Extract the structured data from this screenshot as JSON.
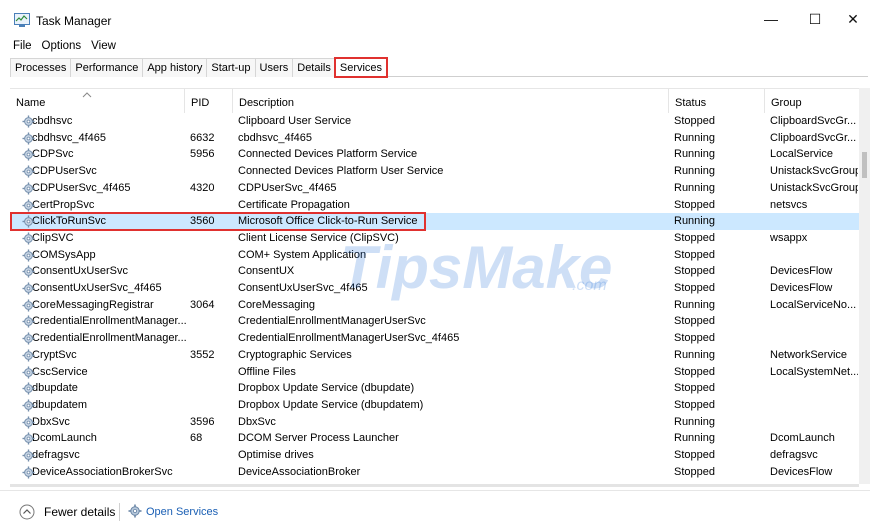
{
  "window": {
    "title": "Task Manager",
    "min_glyph": "—",
    "max_glyph": "☐",
    "close_glyph": "✕"
  },
  "menu": [
    "File",
    "Options",
    "View"
  ],
  "tabs": [
    {
      "label": "Processes",
      "active": false
    },
    {
      "label": "Performance",
      "active": false
    },
    {
      "label": "App history",
      "active": false
    },
    {
      "label": "Start-up",
      "active": false
    },
    {
      "label": "Users",
      "active": false
    },
    {
      "label": "Details",
      "active": false
    },
    {
      "label": "Services",
      "active": true
    }
  ],
  "columns": {
    "name": "Name",
    "pid": "PID",
    "description": "Description",
    "status": "Status",
    "group": "Group"
  },
  "rows": [
    {
      "name": "cbdhsvc",
      "pid": "",
      "description": "Clipboard User Service",
      "status": "Stopped",
      "group": "ClipboardSvcGr..."
    },
    {
      "name": "cbdhsvc_4f465",
      "pid": "6632",
      "description": "cbdhsvc_4f465",
      "status": "Running",
      "group": "ClipboardSvcGr..."
    },
    {
      "name": "CDPSvc",
      "pid": "5956",
      "description": "Connected Devices Platform Service",
      "status": "Running",
      "group": "LocalService"
    },
    {
      "name": "CDPUserSvc",
      "pid": "",
      "description": "Connected Devices Platform User Service",
      "status": "Running",
      "group": "UnistackSvcGroup"
    },
    {
      "name": "CDPUserSvc_4f465",
      "pid": "4320",
      "description": "CDPUserSvc_4f465",
      "status": "Running",
      "group": "UnistackSvcGroup"
    },
    {
      "name": "CertPropSvc",
      "pid": "",
      "description": "Certificate Propagation",
      "status": "Stopped",
      "group": "netsvcs"
    },
    {
      "name": "ClickToRunSvc",
      "pid": "3560",
      "description": "Microsoft Office Click-to-Run Service",
      "status": "Running",
      "group": "",
      "selected": true
    },
    {
      "name": "ClipSVC",
      "pid": "",
      "description": "Client License Service (ClipSVC)",
      "status": "Stopped",
      "group": "wsappx"
    },
    {
      "name": "COMSysApp",
      "pid": "",
      "description": "COM+ System Application",
      "status": "Stopped",
      "group": ""
    },
    {
      "name": "ConsentUxUserSvc",
      "pid": "",
      "description": "ConsentUX",
      "status": "Stopped",
      "group": "DevicesFlow"
    },
    {
      "name": "ConsentUxUserSvc_4f465",
      "pid": "",
      "description": "ConsentUxUserSvc_4f465",
      "status": "Stopped",
      "group": "DevicesFlow"
    },
    {
      "name": "CoreMessagingRegistrar",
      "pid": "3064",
      "description": "CoreMessaging",
      "status": "Running",
      "group": "LocalServiceNo..."
    },
    {
      "name": "CredentialEnrollmentManager...",
      "pid": "",
      "description": "CredentialEnrollmentManagerUserSvc",
      "status": "Stopped",
      "group": ""
    },
    {
      "name": "CredentialEnrollmentManager...",
      "pid": "",
      "description": "CredentialEnrollmentManagerUserSvc_4f465",
      "status": "Stopped",
      "group": ""
    },
    {
      "name": "CryptSvc",
      "pid": "3552",
      "description": "Cryptographic Services",
      "status": "Running",
      "group": "NetworkService"
    },
    {
      "name": "CscService",
      "pid": "",
      "description": "Offline Files",
      "status": "Stopped",
      "group": "LocalSystemNet..."
    },
    {
      "name": "dbupdate",
      "pid": "",
      "description": "Dropbox Update Service (dbupdate)",
      "status": "Stopped",
      "group": ""
    },
    {
      "name": "dbupdatem",
      "pid": "",
      "description": "Dropbox Update Service (dbupdatem)",
      "status": "Stopped",
      "group": ""
    },
    {
      "name": "DbxSvc",
      "pid": "3596",
      "description": "DbxSvc",
      "status": "Running",
      "group": ""
    },
    {
      "name": "DcomLaunch",
      "pid": "68",
      "description": "DCOM Server Process Launcher",
      "status": "Running",
      "group": "DcomLaunch"
    },
    {
      "name": "defragsvc",
      "pid": "",
      "description": "Optimise drives",
      "status": "Stopped",
      "group": "defragsvc"
    },
    {
      "name": "DeviceAssociationBrokerSvc",
      "pid": "",
      "description": "DeviceAssociationBroker",
      "status": "Stopped",
      "group": "DevicesFlow"
    }
  ],
  "footer": {
    "fewer_details": "Fewer details",
    "open_services": "Open Services"
  },
  "watermark": "TipsMake.com",
  "colors": {
    "selected_row": "#cce8ff",
    "highlight_border": "#e0312f",
    "link": "#1a5fb4"
  }
}
